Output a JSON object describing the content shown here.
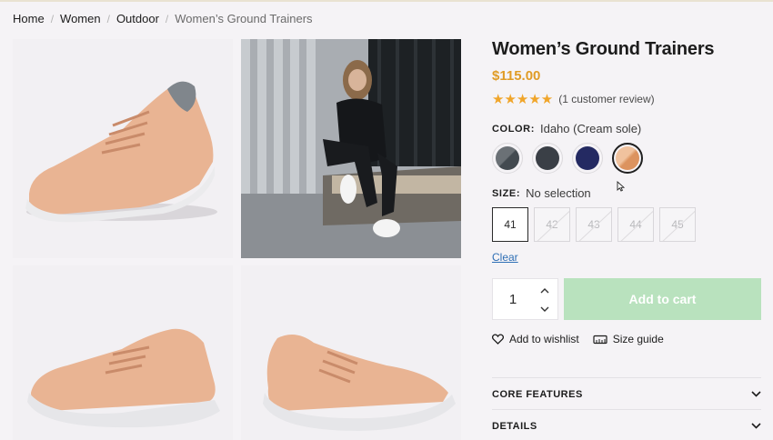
{
  "breadcrumb": [
    "Home",
    "Women",
    "Outdoor",
    "Women’s Ground Trainers"
  ],
  "product": {
    "title": "Women’s Ground Trainers",
    "price": "$115.00",
    "rating": 5,
    "stars": "★★★★★",
    "review_text": "(1 customer review)"
  },
  "color": {
    "label": "COLOR:",
    "value": "Idaho (Cream sole)",
    "swatches": [
      {
        "name": "grey",
        "color": "#4d5358",
        "selected": false
      },
      {
        "name": "charcoal",
        "color": "#3a3f46",
        "selected": false
      },
      {
        "name": "navy",
        "color": "#242a62",
        "selected": false
      },
      {
        "name": "idaho",
        "color": "#e3a172",
        "selected": true
      }
    ]
  },
  "size": {
    "label": "SIZE:",
    "value": "No selection",
    "options": [
      "41",
      "42",
      "43",
      "44",
      "45"
    ]
  },
  "clear_label": "Clear",
  "quantity": "1",
  "add_to_cart": "Add to cart",
  "wishlist_label": "Add to wishlist",
  "size_guide_label": "Size guide",
  "accordion": [
    "CORE FEATURES",
    "DETAILS"
  ],
  "colors": {
    "price": "#e09c26",
    "star": "#f0a52a",
    "cart_button": "#b9e2be",
    "link": "#2f6fb5"
  }
}
